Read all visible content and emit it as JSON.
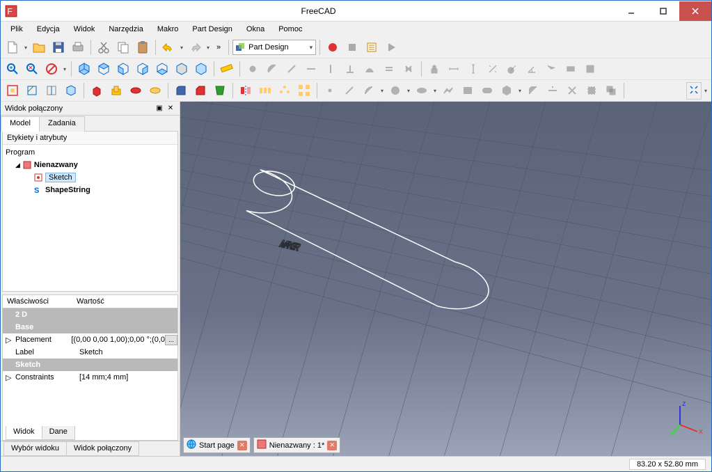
{
  "window": {
    "title": "FreeCAD"
  },
  "menu": {
    "items": [
      "Plik",
      "Edycja",
      "Widok",
      "Narzędzia",
      "Makro",
      "Part Design",
      "Okna",
      "Pomoc"
    ]
  },
  "workbench": {
    "selected": "Part Design"
  },
  "leftPanel": {
    "title": "Widok połączony",
    "tabs": {
      "model": "Model",
      "tasks": "Zadania"
    },
    "treeHeader": "Etykiety i atrybuty",
    "tree": {
      "root": "Program",
      "doc": "Nienazwany",
      "item1": "Sketch",
      "item2": "ShapeString"
    },
    "props": {
      "colProp": "Właściwości",
      "colVal": "Wartość",
      "cat1": "2 D",
      "cat2": "Base",
      "placementLbl": "Placement",
      "placementVal": "[(0,00 0,00 1,00);0,00 °;(0,0",
      "labelLbl": "Label",
      "labelVal": "Sketch",
      "cat3": "Sketch",
      "constraintsLbl": "Constraints",
      "constraintsVal": "[14 mm;4 mm]"
    },
    "bottomTabs": {
      "view": "Widok",
      "data": "Dane"
    },
    "lowerTabs": {
      "sel": "Wybór widoku",
      "combo": "Widok połączony"
    }
  },
  "viewport": {
    "text3d": "MAKER",
    "docTabs": {
      "start": "Start page",
      "unnamed": "Nienazwany : 1*"
    },
    "axes": {
      "x": "x",
      "y": "y",
      "z": "z"
    }
  },
  "status": {
    "coords": "83.20 x 52.80 mm"
  }
}
